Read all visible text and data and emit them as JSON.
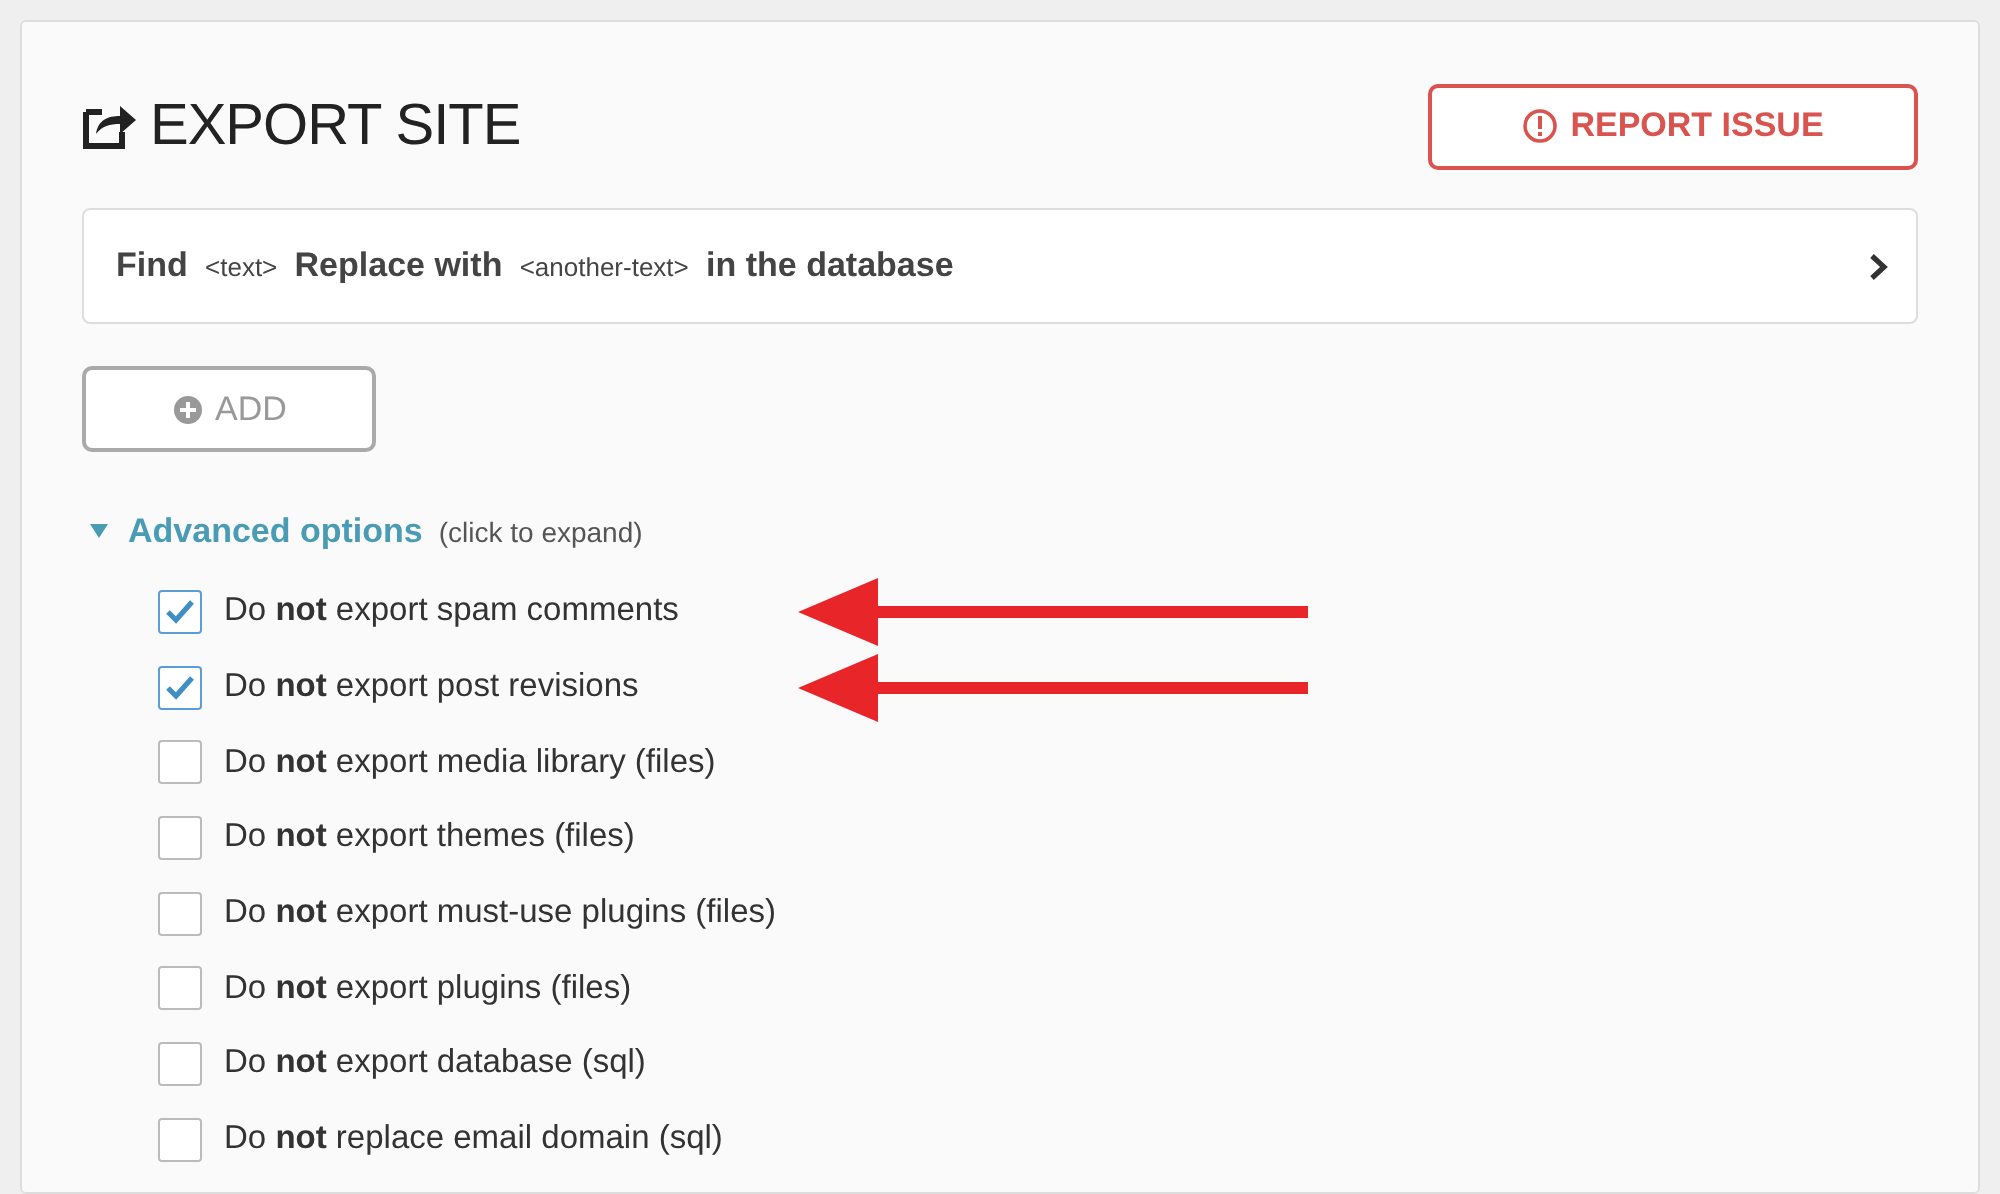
{
  "title": "EXPORT SITE",
  "report_button": "REPORT ISSUE",
  "find_replace": [
    {
      "kind": "strong",
      "text": "Find"
    },
    {
      "kind": "code",
      "text": "<text>"
    },
    {
      "kind": "strong",
      "text": "Replace with"
    },
    {
      "kind": "code",
      "text": "<another-text>"
    },
    {
      "kind": "strong",
      "text": "in the database"
    }
  ],
  "add_button": "ADD",
  "advanced": {
    "label": "Advanced options",
    "hint": "(click to expand)",
    "expanded": true
  },
  "options": [
    {
      "label": "Do **not** export spam comments",
      "checked": true,
      "arrow": true
    },
    {
      "label": "Do **not** export post revisions",
      "checked": true,
      "arrow": true
    },
    {
      "label": "Do **not** export media library (files)",
      "checked": false,
      "arrow": false
    },
    {
      "label": "Do **not** export themes (files)",
      "checked": false,
      "arrow": false
    },
    {
      "label": "Do **not** export must-use plugins (files)",
      "checked": false,
      "arrow": false
    },
    {
      "label": "Do **not** export plugins (files)",
      "checked": false,
      "arrow": false
    },
    {
      "label": "Do **not** export database (sql)",
      "checked": false,
      "arrow": false
    },
    {
      "label": "Do **not** replace email domain (sql)",
      "checked": false,
      "arrow": false
    }
  ]
}
